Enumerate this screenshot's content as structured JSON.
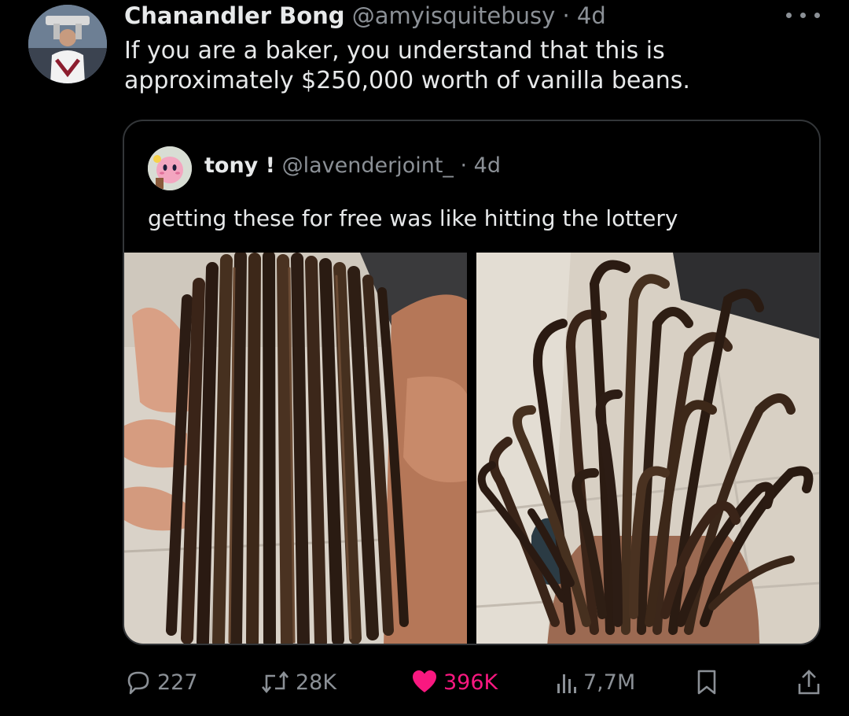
{
  "tweet": {
    "author": {
      "name": "Chanandler Bong",
      "handle": "@amyisquitebusy",
      "time": "· 4d"
    },
    "text": "If you are a baker, you understand that this is approximately $250,000 worth of vanilla beans.",
    "quote": {
      "name": "tony !",
      "handle": "@lavenderjoint_",
      "time": "· 4d",
      "text": "getting these for free was like hitting the lottery"
    },
    "actions": {
      "replies": "227",
      "retweets": "28K",
      "likes": "396K",
      "views": "7,7M"
    }
  },
  "colors": {
    "background": "#000000",
    "text": "#e7e9ea",
    "muted": "#8b9096",
    "like": "#f91880",
    "border": "#333639"
  },
  "icons": [
    "more-icon",
    "reply-icon",
    "retweet-icon",
    "like-icon",
    "views-icon",
    "bookmark-icon",
    "share-icon"
  ]
}
